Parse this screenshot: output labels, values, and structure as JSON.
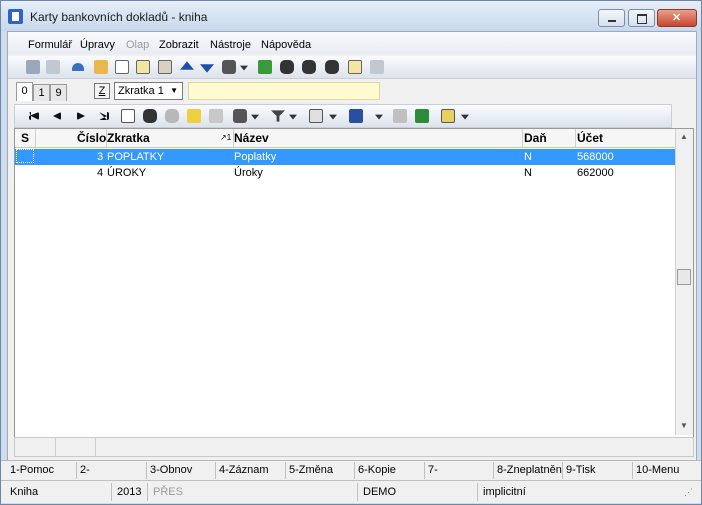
{
  "window": {
    "title": "Karty bankovních dokladů - kniha",
    "accent": "#3399ff"
  },
  "menu": [
    "Formulář",
    "Úpravy",
    "Olap",
    "Zobrazit",
    "Nástroje",
    "Nápověda"
  ],
  "tabs": [
    "0",
    "1",
    "9"
  ],
  "filter": {
    "z_label": "Z",
    "selected_index": "Zkratka 1"
  },
  "table": {
    "headers": [
      "S",
      "Číslo",
      "Zkratka",
      "Název",
      "Daň",
      "Účet"
    ],
    "rows": [
      {
        "cislo": "3",
        "zkratka": "POPLATKY",
        "nazev": "Poplatky",
        "dan": "N",
        "ucet": "568000",
        "selected": true
      },
      {
        "cislo": "4",
        "zkratka": "ÚROKY",
        "nazev": "Úroky",
        "dan": "N",
        "ucet": "662000",
        "selected": false
      }
    ]
  },
  "fkeys": [
    "1-Pomoc",
    "2-",
    "3-Obnov",
    "4-Záznam",
    "5-Změna",
    "6-Kopie",
    "7-",
    "8-Zneplatněn",
    "9-Tisk",
    "10-Menu"
  ],
  "status": {
    "module": "Kniha",
    "year": "2013",
    "mode": "PŘES",
    "db": "DEMO",
    "profile": "implicitní"
  }
}
